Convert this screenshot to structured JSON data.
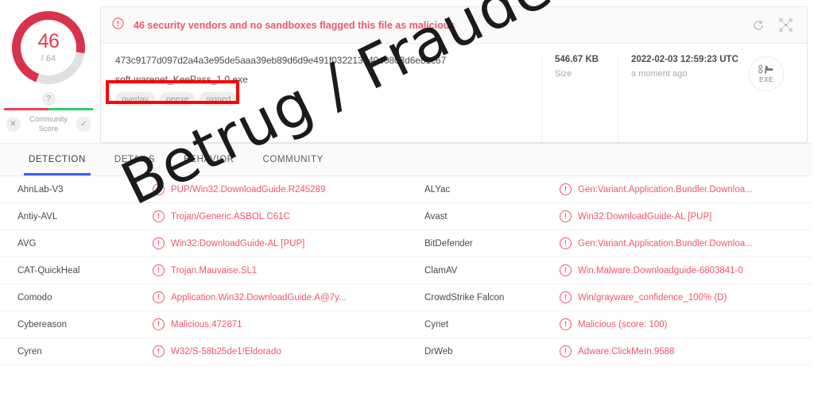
{
  "score_widget": {
    "detections": "46",
    "total": "/ 64",
    "help_icon": "question-mark-icon",
    "negative_icon": "x-mark-icon",
    "positive_icon": "check-mark-icon",
    "community_label_line1": "Community",
    "community_label_line2": "Score",
    "donut_color": "#d8334a",
    "donut_track_color": "#e0e0e0",
    "score_number_color": "#e8384f"
  },
  "alert": {
    "icon": "exclamation-circle-icon",
    "text": "46 security vendors and no sandboxes flagged this file as malicious",
    "text_color": "#f2546c",
    "reload_icon": "reload-icon",
    "expand_icon": "expand-icon"
  },
  "file_info": {
    "hash": "473c9177d097d2a4a3e95de5aaa39eb89d6d9e491f032213740e0803d6e81c67",
    "filename": "soft-warenet_KeePass_1.0.exe",
    "tags": [
      "overlay",
      "peexe",
      "signed"
    ],
    "size_value": "546.67 KB",
    "size_label": "Size",
    "date_value": "2022-02-03 12:59:23 UTC",
    "date_label": "a moment ago",
    "file_type_badge": "EXE",
    "file_type_icon": "executable-icon"
  },
  "tabs": [
    {
      "label": "DETECTION",
      "active": true
    },
    {
      "label": "DETAILS",
      "active": false
    },
    {
      "label": "BEHAVIOR",
      "active": false
    },
    {
      "label": "COMMUNITY",
      "active": false
    }
  ],
  "detections": {
    "left_column": [
      {
        "vendor": "AhnLab-V3",
        "verdict": "PUP/Win32.DownloadGuide.R245289"
      },
      {
        "vendor": "Antiy-AVL",
        "verdict": "Trojan/Generic.ASBOL.C61C"
      },
      {
        "vendor": "AVG",
        "verdict": "Win32:DownloadGuide-AL [PUP]"
      },
      {
        "vendor": "CAT-QuickHeal",
        "verdict": "Trojan.Mauvaise.SL1"
      },
      {
        "vendor": "Comodo",
        "verdict": "Application.Win32.DownloadGuide.A@7y..."
      },
      {
        "vendor": "Cybereason",
        "verdict": "Malicious.472871"
      },
      {
        "vendor": "Cyren",
        "verdict": "W32/S-58b25de1!Eldorado"
      }
    ],
    "right_column": [
      {
        "vendor": "ALYac",
        "verdict": "Gen:Variant.Application.Bundler.Downloa..."
      },
      {
        "vendor": "Avast",
        "verdict": "Win32:DownloadGuide-AL [PUP]"
      },
      {
        "vendor": "BitDefender",
        "verdict": "Gen:Variant.Application.Bundler.Downloa..."
      },
      {
        "vendor": "ClamAV",
        "verdict": "Win.Malware.Downloadguide-6803841-0"
      },
      {
        "vendor": "CrowdStrike Falcon",
        "verdict": "Win/grayware_confidence_100% (D)"
      },
      {
        "vendor": "Cynet",
        "verdict": "Malicious (score: 100)"
      },
      {
        "vendor": "DrWeb",
        "verdict": "Adware.ClickMeIn.9588"
      }
    ],
    "verdict_color": "#f2546c"
  },
  "annotations": {
    "highlight_box_color": "#ff0000",
    "watermark_text": "Betrug / Fraude / Frode / Fraud"
  }
}
